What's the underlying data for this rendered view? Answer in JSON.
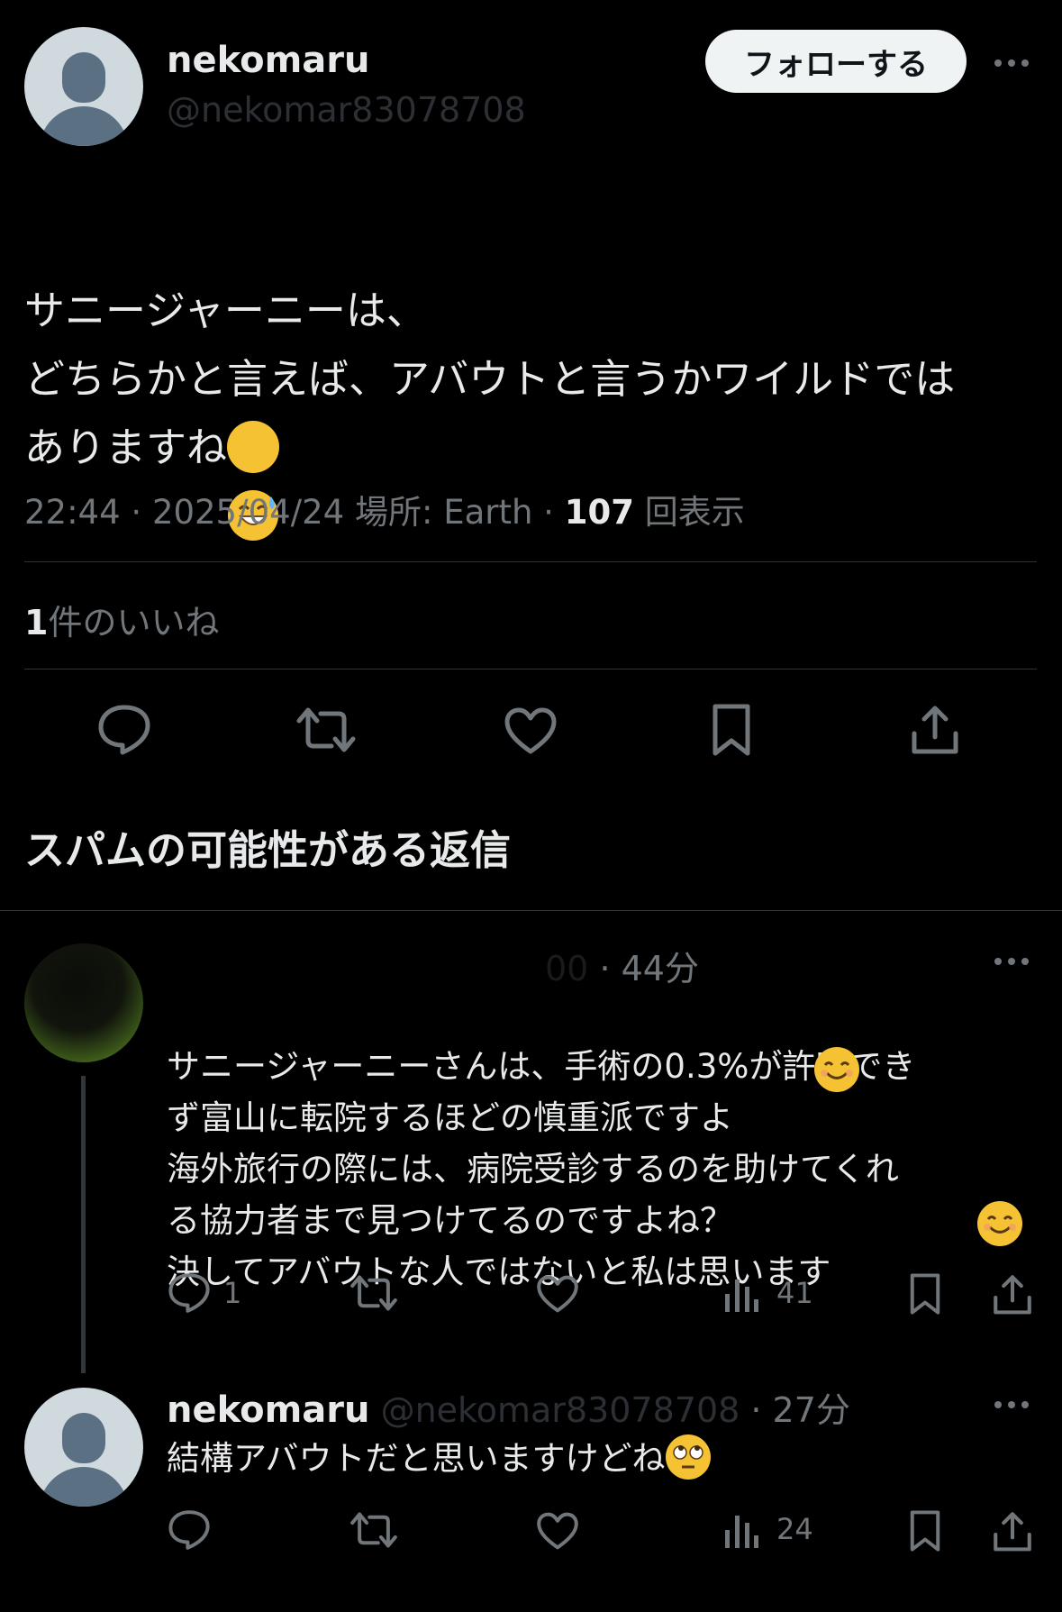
{
  "main_post": {
    "name": "nekomaru",
    "handle": "@nekomar83078708",
    "follow_label": "フォローする",
    "text": "サニージャーニーは、\nどちらかと言えば、アバウトと言うかワイルドでは\nありますね",
    "emoji": "sweat-smile-emoji",
    "time": "22:44",
    "date": "2025/04/24",
    "location_label": "場所: Earth",
    "views_count": "107",
    "views_label": "回表示",
    "likes_count": "1",
    "likes_label": "件のいいね"
  },
  "section_title": "スパムの可能性がある返信",
  "replies": [
    {
      "handle_visible": "00",
      "time": "44分",
      "text": "サニージャーニーさんは、手術の0.3%が許容でき\nず富山に転院するほどの慎重派ですよ\n海外旅行の際には、病院受診するのを助けてくれ\nる協力者まで見つけてるのですよね？\n決してアバウトな人ではないと私は思います",
      "reply_count": "1",
      "views": "41"
    },
    {
      "name": "nekomaru",
      "handle": "@nekomar83078708",
      "time": "27分",
      "text": "結構アバウトだと思いますけどね",
      "views": "24"
    }
  ],
  "colors": {
    "background": "#000000",
    "text": "#e7e9ea",
    "muted": "#71767b",
    "divider": "#2f3336"
  }
}
